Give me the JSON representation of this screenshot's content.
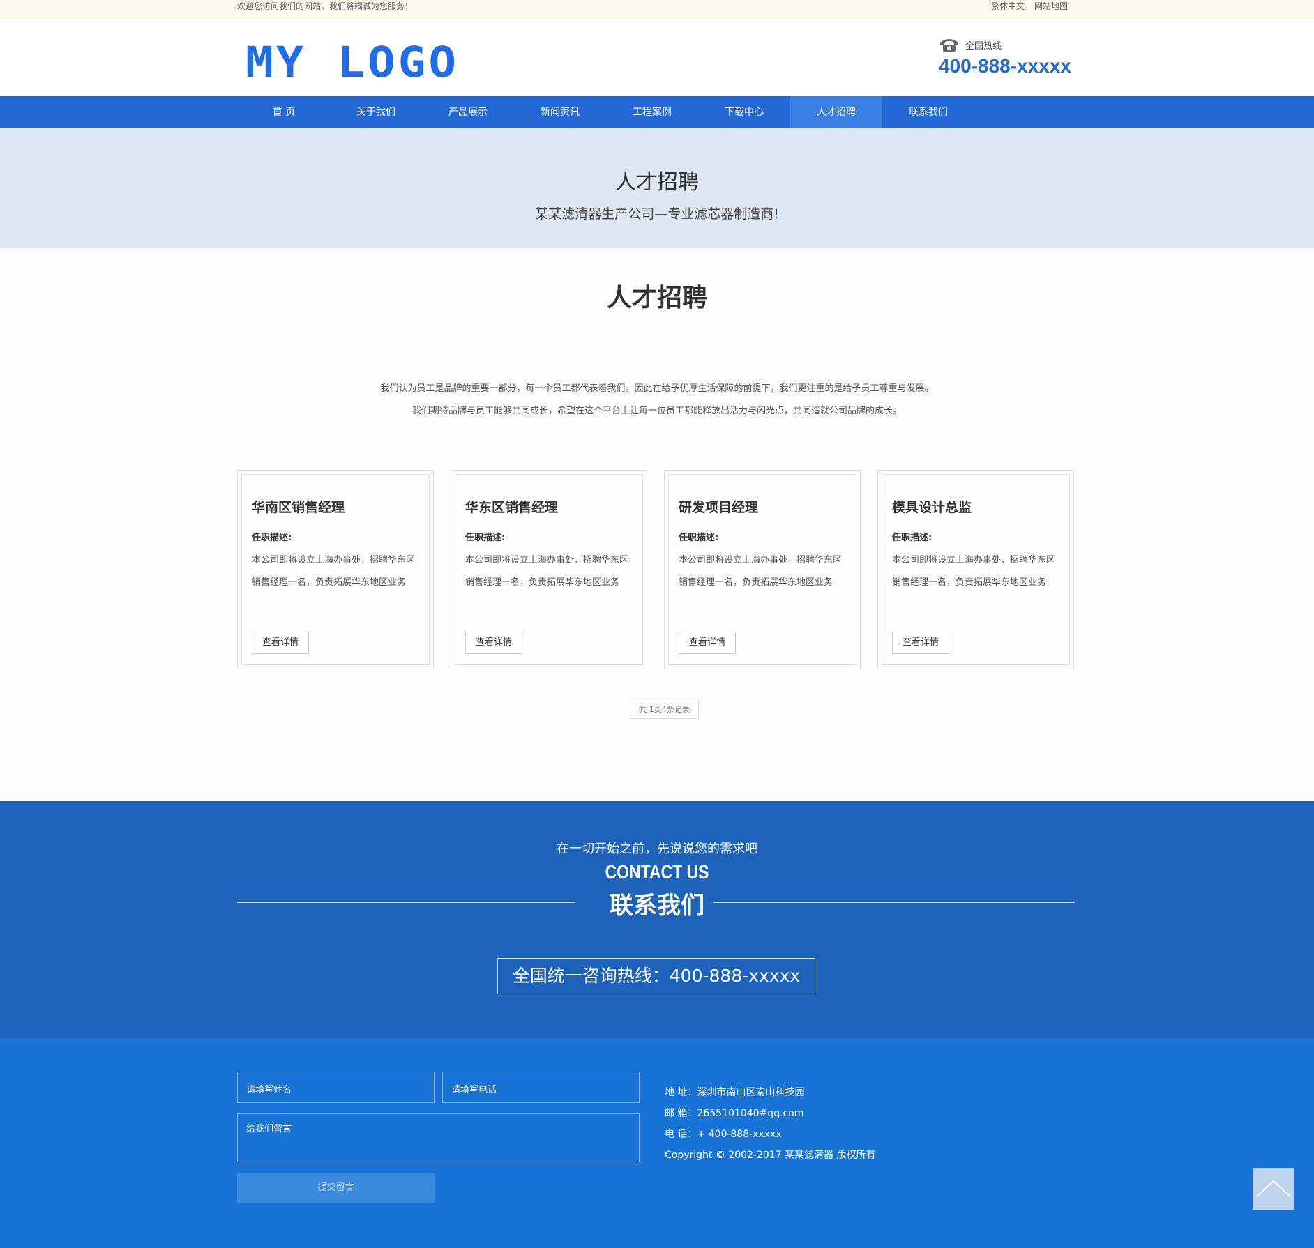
{
  "topbar": {
    "welcome": "欢迎您访问我们的网站，我们将竭诚为您服务！",
    "links": [
      "繁体中文",
      "网站地图"
    ]
  },
  "header": {
    "logo": "MY LOGO",
    "hotline_label": "全国热线",
    "hotline_number": "400-888-xxxxx"
  },
  "nav": {
    "items": [
      "首 页",
      "关于我们",
      "产品展示",
      "新闻资讯",
      "工程案例",
      "下载中心",
      "人才招聘",
      "联系我们"
    ],
    "active": "人才招聘"
  },
  "banner": {
    "title": "人才招聘",
    "subtitle": "某某滤清器生产公司—专业滤芯器制造商!"
  },
  "main": {
    "heading": "人才招聘",
    "intro": [
      "我们认为员工是品牌的重要一部分，每一个员工都代表着我们。因此在给予优厚生活保障的前提下，我们更注重的是给予员工尊重与发展。",
      "我们期待品牌与员工能够共同成长，希望在这个平台上让每一位员工都能释放出活力与闪光点，共同造就公司品牌的成长。"
    ],
    "jobs": [
      {
        "title": "华南区销售经理",
        "desc_label": "任职描述:",
        "desc": "本公司即将设立上海办事处，招聘华东区销售经理一名，负责拓展华东地区业务",
        "button": "查看详情"
      },
      {
        "title": "华东区销售经理",
        "desc_label": "任职描述:",
        "desc": "本公司即将设立上海办事处，招聘华东区销售经理一名，负责拓展华东地区业务",
        "button": "查看详情"
      },
      {
        "title": "研发项目经理",
        "desc_label": "任职描述:",
        "desc": "本公司即将设立上海办事处，招聘华东区销售经理一名，负责拓展华东地区业务",
        "button": "查看详情"
      },
      {
        "title": "模具设计总监",
        "desc_label": "任职描述:",
        "desc": "本公司即将设立上海办事处，招聘华东区销售经理一名，负责拓展华东地区业务",
        "button": "查看详情"
      }
    ],
    "pager": "共 1页4条记录"
  },
  "contact": {
    "lead": "在一切开始之前，先说说您的需求吧",
    "en_title": "CONTACT US",
    "cn_title": "联系我们",
    "hotline": "全国统一咨询热线：400-888-xxxxx"
  },
  "footer": {
    "name_placeholder": "请填写姓名",
    "phone_placeholder": "请填写电话",
    "message_placeholder": "给我们留言",
    "submit": "提交留言",
    "address": "地 址：深圳市南山区南山科技园",
    "email": "邮 箱：2655101040#qq.com",
    "phone": "电 话：+ 400-888-xxxxx",
    "copyright": "Copyright © 2002-2017 某某滤清器 版权所有"
  },
  "colors": {
    "brand": "#1f6ee6",
    "nav": "#2468d6",
    "contact_band": "#1d63bc",
    "footer": "#1774d6"
  }
}
